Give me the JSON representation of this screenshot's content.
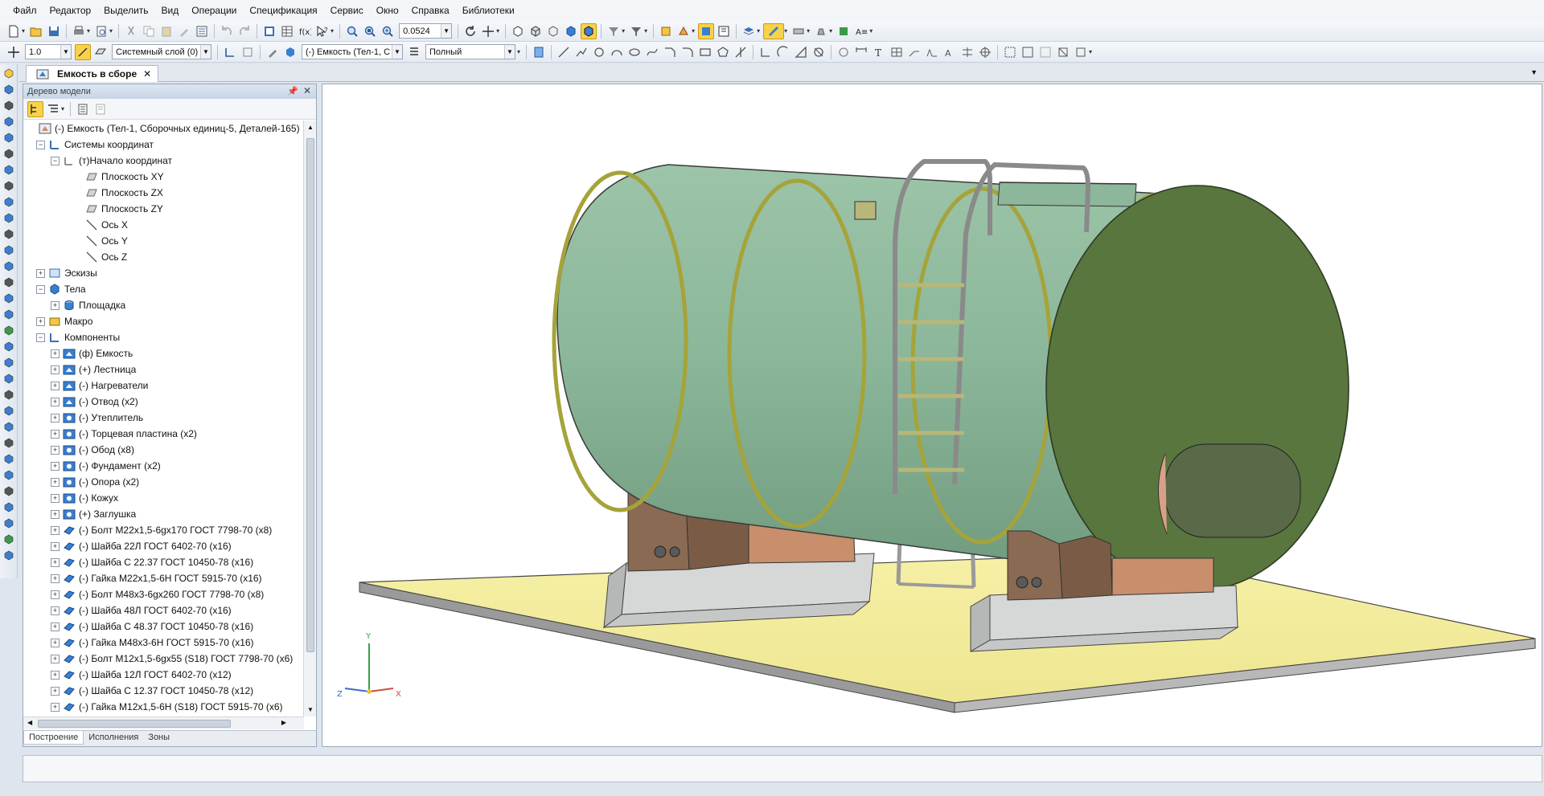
{
  "menu": [
    "Файл",
    "Редактор",
    "Выделить",
    "Вид",
    "Операции",
    "Спецификация",
    "Сервис",
    "Окно",
    "Справка",
    "Библиотеки"
  ],
  "toolbar1": {
    "zoom_value": "0.0524"
  },
  "toolbar2": {
    "step_value": "1.0",
    "layer_value": "Системный слой (0)",
    "part_value": "(-) Емкость (Тел-1, С",
    "display_mode": "Полный"
  },
  "document_tab": {
    "title": "Емкость в сборе"
  },
  "tree": {
    "header": "Дерево модели",
    "rows": [
      {
        "label": "(-) Емкость (Тел-1, Сборочных единиц-5, Деталей-165)",
        "icon": "assembly-root-icon"
      },
      {
        "label": "Системы координат",
        "icon": "coordinate-systems-icon"
      },
      {
        "label": "(т)Начало координат",
        "icon": "origin-icon"
      },
      {
        "label": "Плоскость XY",
        "icon": "plane-icon"
      },
      {
        "label": "Плоскость ZX",
        "icon": "plane-icon"
      },
      {
        "label": "Плоскость ZY",
        "icon": "plane-icon"
      },
      {
        "label": "Ось X",
        "icon": "axis-icon"
      },
      {
        "label": "Ось Y",
        "icon": "axis-icon"
      },
      {
        "label": "Ось Z",
        "icon": "axis-icon"
      },
      {
        "label": "Эскизы",
        "icon": "sketches-icon"
      },
      {
        "label": "Тела",
        "icon": "bodies-icon"
      },
      {
        "label": "Площадка",
        "icon": "body-icon"
      },
      {
        "label": "Макро",
        "icon": "macro-icon"
      },
      {
        "label": "Компоненты",
        "icon": "components-icon"
      },
      {
        "label": "(ф) Емкость",
        "icon": "subassembly-icon"
      },
      {
        "label": "(+) Лестница",
        "icon": "subassembly-icon"
      },
      {
        "label": "(-) Нагреватели",
        "icon": "subassembly-icon"
      },
      {
        "label": "(-) Отвод (x2)",
        "icon": "subassembly-icon"
      },
      {
        "label": "(-) Утеплитель",
        "icon": "part-icon"
      },
      {
        "label": "(-) Торцевая пластина (x2)",
        "icon": "part-icon"
      },
      {
        "label": "(-) Обод (x8)",
        "icon": "part-icon"
      },
      {
        "label": "(-) Фундамент (x2)",
        "icon": "part-icon"
      },
      {
        "label": "(-) Опора (x2)",
        "icon": "part-icon"
      },
      {
        "label": "(-) Кожух",
        "icon": "part-icon"
      },
      {
        "label": "(+) Заглушка",
        "icon": "part-icon"
      },
      {
        "label": "(-) Болт М22х1,5-6gx170 ГОСТ 7798-70 (x8)",
        "icon": "standard-part-icon"
      },
      {
        "label": "(-) Шайба 22Л ГОСТ 6402-70 (x16)",
        "icon": "standard-part-icon"
      },
      {
        "label": "(-) Шайба С 22.37 ГОСТ 10450-78 (x16)",
        "icon": "standard-part-icon"
      },
      {
        "label": "(-) Гайка М22х1,5-6Н ГОСТ 5915-70 (x16)",
        "icon": "standard-part-icon"
      },
      {
        "label": "(-) Болт М48х3-6gx260 ГОСТ 7798-70 (x8)",
        "icon": "standard-part-icon"
      },
      {
        "label": "(-) Шайба 48Л ГОСТ 6402-70 (x16)",
        "icon": "standard-part-icon"
      },
      {
        "label": "(-) Шайба С 48.37 ГОСТ 10450-78 (x16)",
        "icon": "standard-part-icon"
      },
      {
        "label": "(-) Гайка М48х3-6Н ГОСТ 5915-70 (x16)",
        "icon": "standard-part-icon"
      },
      {
        "label": "(-) Болт М12х1,5-6gx55 (S18) ГОСТ 7798-70 (x6)",
        "icon": "standard-part-icon"
      },
      {
        "label": "(-) Шайба 12Л ГОСТ 6402-70 (x12)",
        "icon": "standard-part-icon"
      },
      {
        "label": "(-) Шайба С 12.37 ГОСТ 10450-78 (x12)",
        "icon": "standard-part-icon"
      },
      {
        "label": "(-) Гайка М12х1,5-6Н (S18) ГОСТ 5915-70 (x6)",
        "icon": "standard-part-icon"
      }
    ],
    "bottom_tabs": [
      "Построение",
      "Исполнения",
      "Зоны"
    ]
  },
  "viewport": {
    "triad_labels": {
      "x": "X",
      "y": "Y",
      "z": "Z"
    },
    "colors": {
      "tank": "#8fb89a",
      "end_cap": "#58763e",
      "platform": "#f4ee9e",
      "foundation": "#d4d6d6",
      "support": "#8a6a52",
      "rim": "#a5a33a",
      "hatch": "#5a6a48"
    }
  }
}
